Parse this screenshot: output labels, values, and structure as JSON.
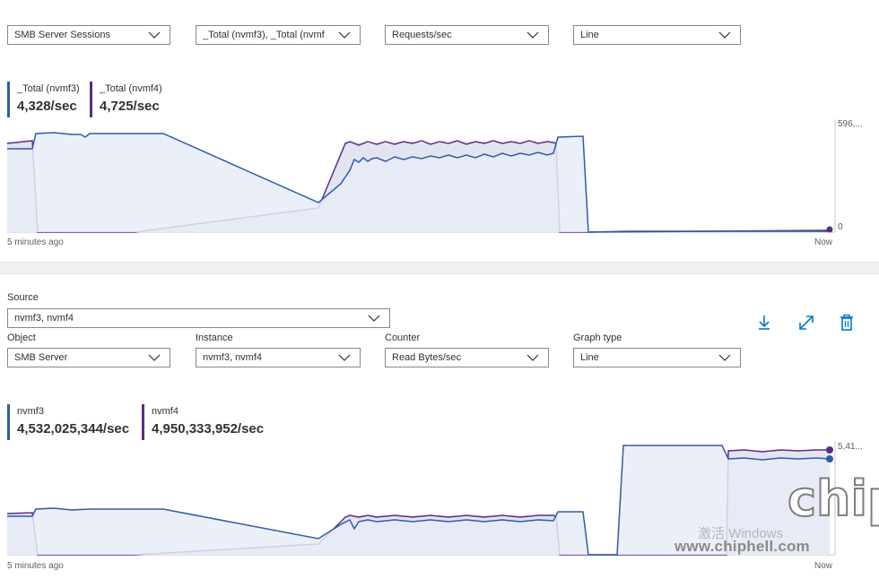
{
  "panel1": {
    "fields": {
      "object": "SMB Server Sessions",
      "instance": "_Total (nvmf3), _Total (nvmf",
      "counter": "Requests/sec",
      "graph_type": "Line"
    },
    "legend": [
      {
        "name": "_Total (nvmf3)",
        "value": "4,328/sec",
        "color": "#2f5ba7"
      },
      {
        "name": "_Total (nvmf4)",
        "value": "4,725/sec",
        "color": "#5b2d86"
      }
    ],
    "y_top": "596,...",
    "y_bottom": "0",
    "time_start": "5 minutes ago",
    "time_end": "Now"
  },
  "panel2": {
    "labels": {
      "source": "Source",
      "object": "Object",
      "instance": "Instance",
      "counter": "Counter",
      "graph_type": "Graph type"
    },
    "fields": {
      "source": "nvmf3, nvmf4",
      "object": "SMB Server",
      "instance": "nvmf3, nvmf4",
      "counter": "Read Bytes/sec",
      "graph_type": "Line"
    },
    "legend": [
      {
        "name": "nvmf3",
        "value": "4,532,025,344/sec",
        "color": "#2f5ba7"
      },
      {
        "name": "nvmf4",
        "value": "4,950,333,952/sec",
        "color": "#5b2d86"
      }
    ],
    "y_top": "5,41...",
    "time_start": "5 minutes ago",
    "time_end": "Now",
    "actions": {
      "download": "download-icon",
      "expand": "expand-icon",
      "delete": "trash-icon"
    }
  },
  "watermark": {
    "activate": "激活 Windows",
    "url": "www.chiphell.com",
    "logo": "chip"
  },
  "colors": {
    "series_blue": "#2f5ba7",
    "series_purple": "#5b2d86",
    "accent": "#0078d4"
  }
}
